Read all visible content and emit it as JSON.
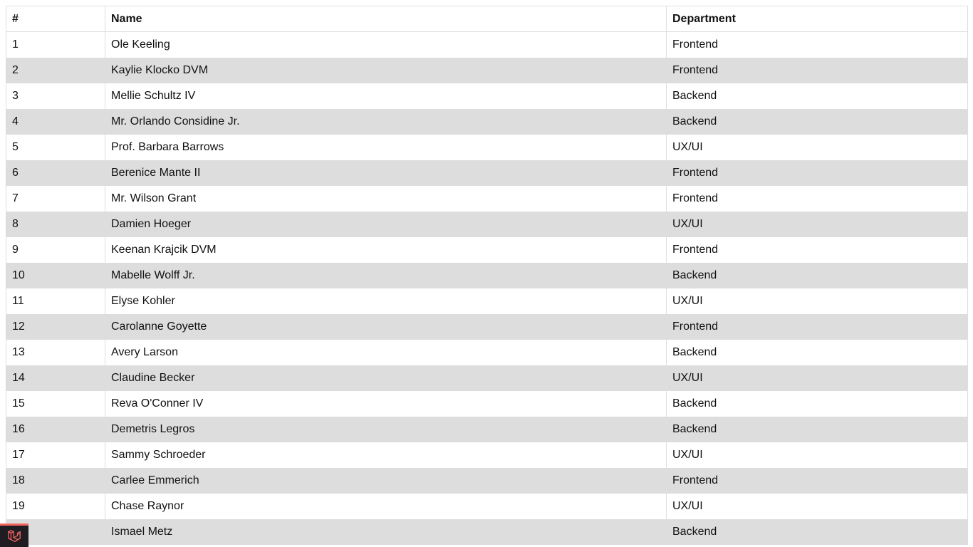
{
  "table": {
    "headers": [
      "#",
      "Name",
      "Department"
    ],
    "rows": [
      {
        "num": "1",
        "name": "Ole Keeling",
        "department": "Frontend"
      },
      {
        "num": "2",
        "name": "Kaylie Klocko DVM",
        "department": "Frontend"
      },
      {
        "num": "3",
        "name": "Mellie Schultz IV",
        "department": "Backend"
      },
      {
        "num": "4",
        "name": "Mr. Orlando Considine Jr.",
        "department": "Backend"
      },
      {
        "num": "5",
        "name": "Prof. Barbara Barrows",
        "department": "UX/UI"
      },
      {
        "num": "6",
        "name": "Berenice Mante II",
        "department": "Frontend"
      },
      {
        "num": "7",
        "name": "Mr. Wilson Grant",
        "department": "Frontend"
      },
      {
        "num": "8",
        "name": "Damien Hoeger",
        "department": "UX/UI"
      },
      {
        "num": "9",
        "name": "Keenan Krajcik DVM",
        "department": "Frontend"
      },
      {
        "num": "10",
        "name": "Mabelle Wolff Jr.",
        "department": "Backend"
      },
      {
        "num": "11",
        "name": "Elyse Kohler",
        "department": "UX/UI"
      },
      {
        "num": "12",
        "name": "Carolanne Goyette",
        "department": "Frontend"
      },
      {
        "num": "13",
        "name": "Avery Larson",
        "department": "Backend"
      },
      {
        "num": "14",
        "name": "Claudine Becker",
        "department": "UX/UI"
      },
      {
        "num": "15",
        "name": "Reva O'Conner IV",
        "department": "Backend"
      },
      {
        "num": "16",
        "name": "Demetris Legros",
        "department": "Backend"
      },
      {
        "num": "17",
        "name": "Sammy Schroeder",
        "department": "UX/UI"
      },
      {
        "num": "18",
        "name": "Carlee Emmerich",
        "department": "Frontend"
      },
      {
        "num": "19",
        "name": "Chase Raynor",
        "department": "UX/UI"
      },
      {
        "num": "",
        "name": "Ismael Metz",
        "department": "Backend"
      }
    ]
  },
  "debugbar": {
    "icon": "laravel-logo-icon",
    "accent_color": "#f4645f",
    "background_color": "#1f1d22"
  }
}
